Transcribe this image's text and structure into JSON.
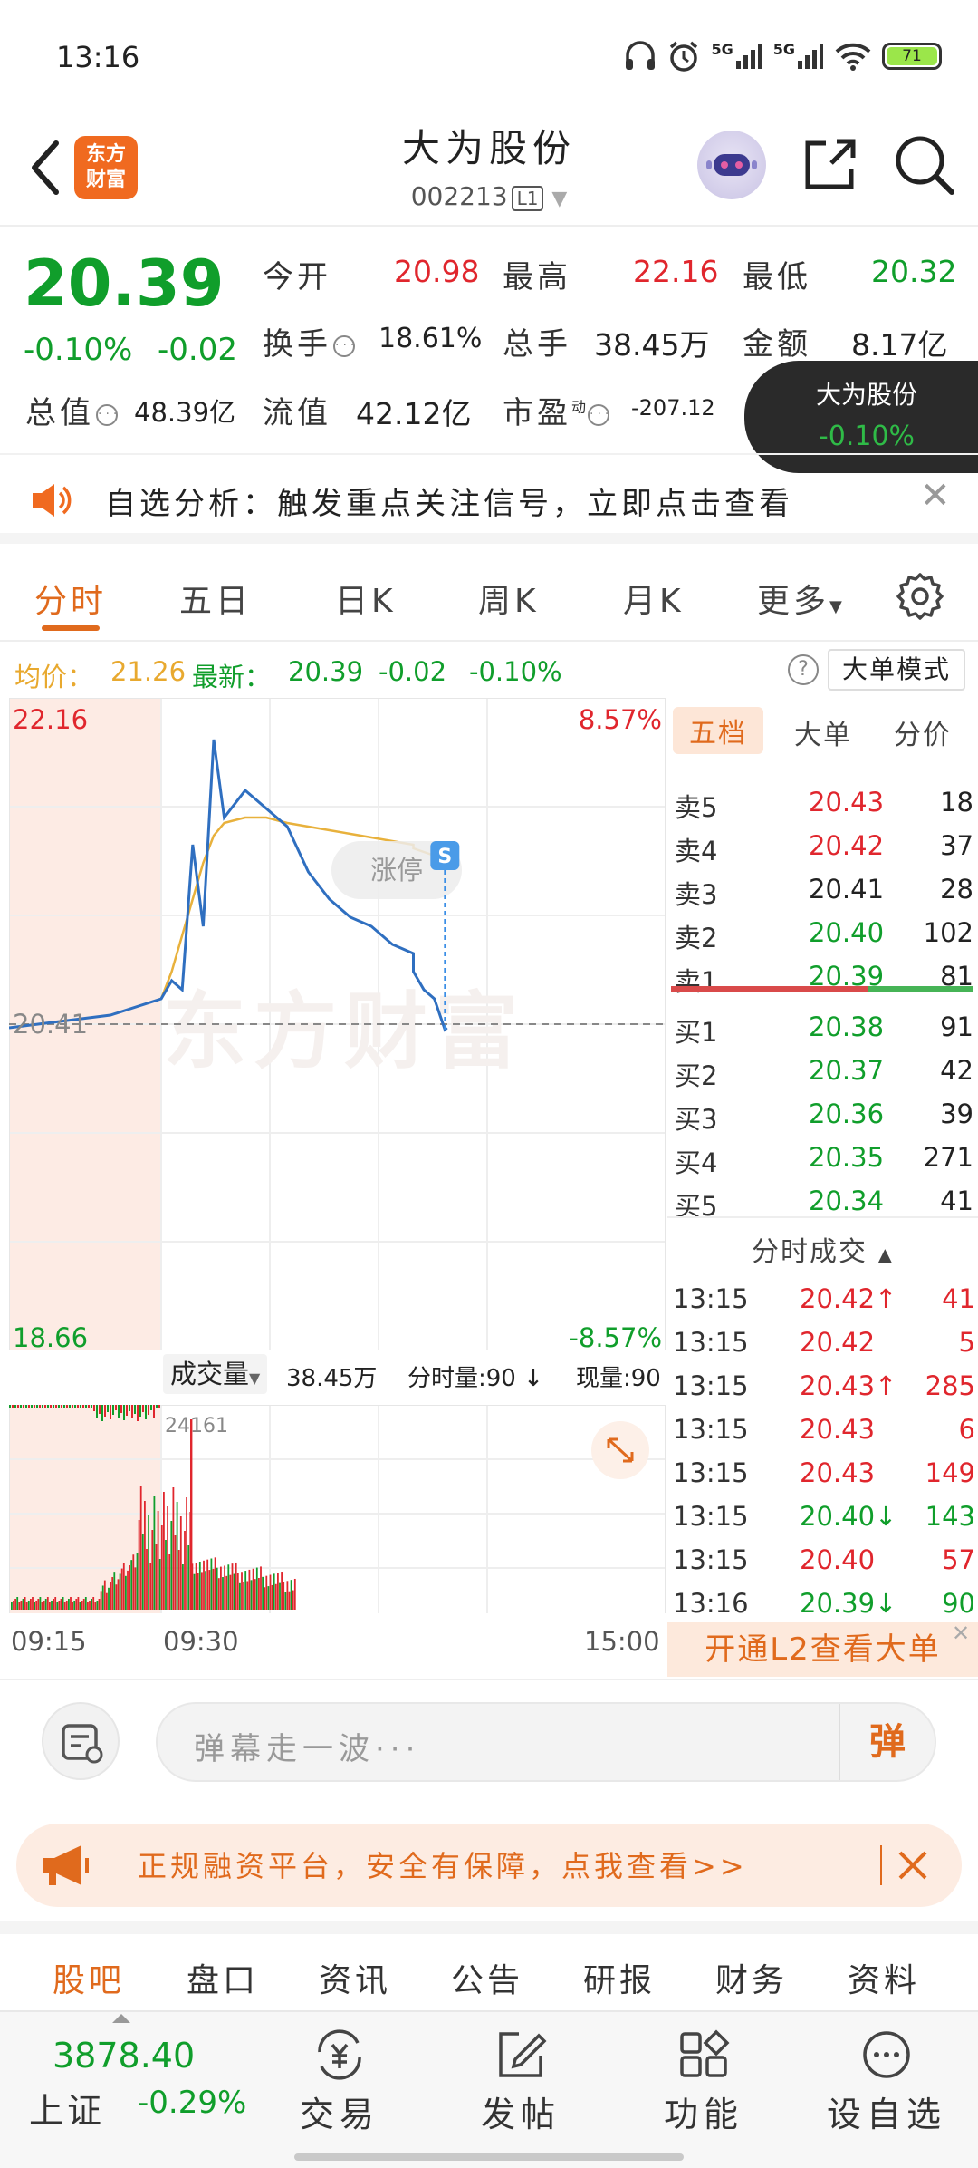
{
  "status_bar": {
    "time": "13:16",
    "net1": "5G",
    "net2": "5G",
    "battery": "71"
  },
  "header": {
    "back_icon": "chevron-left-icon",
    "logo_line1": "东方",
    "logo_line2": "财富",
    "stock_name": "大为股份",
    "stock_code": "002213",
    "level": "L1"
  },
  "quote": {
    "price": "20.39",
    "change_pct": "-0.10%",
    "change_amt": "-0.02",
    "open_label": "今开",
    "open": "20.98",
    "high_label": "最高",
    "high": "22.16",
    "low_label": "最低",
    "low": "20.32",
    "turnover_label": "换手",
    "turnover": "18.61%",
    "volume_label": "总手",
    "volume": "38.45万",
    "amount_label": "金额",
    "amount": "8.17亿",
    "mktcap_label": "总值",
    "mktcap": "48.39亿",
    "float_label": "流值",
    "float_cap": "42.12亿",
    "pe_label": "市盈",
    "pe_sup": "动",
    "pe": "-207.12"
  },
  "float_tip": {
    "name": "大为股份",
    "pct": "-0.10%"
  },
  "notice": {
    "text": "自选分析：触发重点关注信号，立即点击查看",
    "close": "✕"
  },
  "tabs": [
    "分时",
    "五日",
    "日K",
    "周K",
    "月K",
    "更多"
  ],
  "avg_line": {
    "avg_label": "均价：",
    "avg": "21.26",
    "latest_label": "最新：",
    "latest": "20.39",
    "chg": "-0.02",
    "pct": "-0.10%",
    "help": "?",
    "mode_btn": "大单模式"
  },
  "chart_labels": {
    "top_price": "22.16",
    "top_pct": "8.57%",
    "bottom_price": "18.66",
    "bottom_pct": "-8.57%",
    "ref_price": "20.41",
    "limit_up": "涨停",
    "signal": "S",
    "watermark": "东方财富",
    "vol_select": "成交量",
    "vol_total": "38.45万",
    "vol_tick": "分时量:90",
    "vol_now": "现量:90",
    "vol_max": "24161",
    "t_start": "09:15",
    "t_open": "09:30",
    "t_end": "15:00"
  },
  "chart_data": {
    "type": "line",
    "x": [
      "09:15",
      "09:25",
      "09:30",
      "09:35",
      "09:40",
      "09:45",
      "09:50",
      "09:55",
      "10:00",
      "10:10",
      "10:20",
      "10:30",
      "10:40",
      "10:50",
      "11:00",
      "11:10",
      "11:20",
      "11:30",
      "13:00",
      "13:05",
      "13:10",
      "13:15",
      "13:16"
    ],
    "series": [
      {
        "values": [
          20.39,
          20.46,
          20.55,
          20.65,
          20.6,
          21.4,
          20.95,
          21.98,
          21.55,
          21.7,
          21.6,
          21.5,
          21.25,
          21.1,
          21.0,
          20.95,
          20.85,
          20.8,
          20.7,
          20.6,
          20.55,
          20.38,
          20.39
        ]
      },
      {
        "values": [
          null,
          null,
          20.55,
          20.7,
          20.9,
          21.1,
          21.3,
          21.45,
          21.52,
          21.55,
          21.55,
          21.52,
          21.5,
          21.48,
          21.46,
          21.44,
          21.42,
          21.4,
          21.38,
          21.36,
          21.34,
          21.3,
          21.26
        ]
      }
    ],
    "ylim": [
      18.66,
      22.16
    ],
    "pre_close": 20.41,
    "colors": {
      "price": "#2f6fc0",
      "avg": "#e8b13c",
      "up": "#e0262d",
      "down": "#109e2b"
    }
  },
  "book": {
    "tabs": [
      "五档",
      "大单",
      "分价"
    ],
    "asks": [
      {
        "label": "卖5",
        "price": "20.43",
        "qty": "18",
        "c": "red"
      },
      {
        "label": "卖4",
        "price": "20.42",
        "qty": "37",
        "c": "red"
      },
      {
        "label": "卖3",
        "price": "20.41",
        "qty": "28",
        "c": "blk"
      },
      {
        "label": "卖2",
        "price": "20.40",
        "qty": "102",
        "c": "green"
      },
      {
        "label": "卖1",
        "price": "20.39",
        "qty": "81",
        "c": "green"
      }
    ],
    "bids": [
      {
        "label": "买1",
        "price": "20.38",
        "qty": "91",
        "c": "green"
      },
      {
        "label": "买2",
        "price": "20.37",
        "qty": "42",
        "c": "green"
      },
      {
        "label": "买3",
        "price": "20.36",
        "qty": "39",
        "c": "green"
      },
      {
        "label": "买4",
        "price": "20.35",
        "qty": "271",
        "c": "green"
      },
      {
        "label": "买5",
        "price": "20.34",
        "qty": "41",
        "c": "green"
      }
    ],
    "trades_title": "分时成交",
    "trades": [
      {
        "t": "13:15",
        "p": "20.42",
        "arrow": "↑",
        "q": "41",
        "c": "red"
      },
      {
        "t": "13:15",
        "p": "20.42",
        "arrow": "",
        "q": "5",
        "c": "red"
      },
      {
        "t": "13:15",
        "p": "20.43",
        "arrow": "↑",
        "q": "285",
        "c": "red"
      },
      {
        "t": "13:15",
        "p": "20.43",
        "arrow": "",
        "q": "6",
        "c": "red"
      },
      {
        "t": "13:15",
        "p": "20.43",
        "arrow": "",
        "q": "149",
        "c": "red"
      },
      {
        "t": "13:15",
        "p": "20.40",
        "arrow": "↓",
        "q": "143",
        "c": "green"
      },
      {
        "t": "13:15",
        "p": "20.40",
        "arrow": "",
        "q": "57",
        "c": "red"
      },
      {
        "t": "13:16",
        "p": "20.39",
        "arrow": "↓",
        "q": "90",
        "c": "green"
      }
    ],
    "l2_banner": "开通L2查看大单"
  },
  "danmaku": {
    "placeholder": "弹幕走一波···",
    "send": "弹"
  },
  "promo": {
    "text": "正规融资平台，安全有保障，点我查看>>"
  },
  "bottom_tabs": [
    "股吧",
    "盘口",
    "资讯",
    "公告",
    "研报",
    "财务",
    "资料"
  ],
  "footer": {
    "index_value": "3878.40",
    "index_name": "上证",
    "index_pct": "-0.29%",
    "items": [
      {
        "label": "交易",
        "icon": "yuan-trade-icon"
      },
      {
        "label": "发帖",
        "icon": "edit-post-icon"
      },
      {
        "label": "功能",
        "icon": "grid-function-icon"
      },
      {
        "label": "设自选",
        "icon": "more-dots-icon"
      }
    ]
  }
}
